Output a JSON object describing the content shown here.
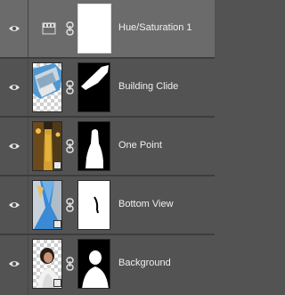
{
  "layers": [
    {
      "name": "Hue/Saturation 1",
      "type": "adjustment",
      "selected": true
    },
    {
      "name": "Building Clide",
      "type": "image"
    },
    {
      "name": "One Point",
      "type": "smart-object"
    },
    {
      "name": "Bottom View",
      "type": "smart-object"
    },
    {
      "name": "Background",
      "type": "smart-object"
    }
  ],
  "colors": {
    "panel_bg": "#535353",
    "selected_bg": "#6b6b6b",
    "text": "#f0f0f0"
  }
}
